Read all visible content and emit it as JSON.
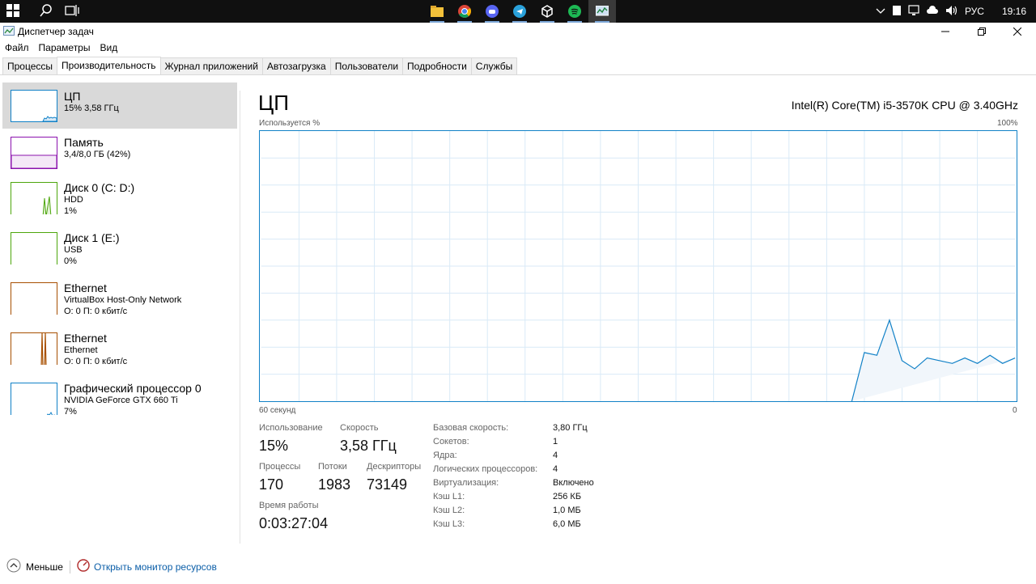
{
  "taskbar": {
    "lang": "РУС",
    "time": "19:16"
  },
  "window": {
    "title": "Диспетчер задач",
    "menu": [
      "Файл",
      "Параметры",
      "Вид"
    ],
    "tabs": [
      "Процессы",
      "Производительность",
      "Журнал приложений",
      "Автозагрузка",
      "Пользователи",
      "Подробности",
      "Службы"
    ],
    "active_tab": 1
  },
  "sidebar": {
    "items": [
      {
        "title": "ЦП",
        "sub1": "15% 3,58 ГГц",
        "sub2": "",
        "sub3": "",
        "color": "#1181c7"
      },
      {
        "title": "Память",
        "sub1": "3,4/8,0 ГБ (42%)",
        "sub2": "",
        "sub3": "",
        "color": "#8b12ae"
      },
      {
        "title": "Диск 0 (C: D:)",
        "sub1": "HDD",
        "sub2": "1%",
        "sub3": "",
        "color": "#4da60c"
      },
      {
        "title": "Диск 1 (E:)",
        "sub1": "USB",
        "sub2": "0%",
        "sub3": "",
        "color": "#4da60c"
      },
      {
        "title": "Ethernet",
        "sub1": "VirtualBox Host-Only Network",
        "sub2": "О: 0 П: 0 кбит/с",
        "sub3": "",
        "color": "#a74f01"
      },
      {
        "title": "Ethernet",
        "sub1": "Ethernet",
        "sub2": "О: 0 П: 0 кбит/с",
        "sub3": "",
        "color": "#a74f01"
      },
      {
        "title": "Графический процессор 0",
        "sub1": "NVIDIA GeForce GTX 660 Ti",
        "sub2": "7%",
        "sub3": "",
        "color": "#1181c7"
      }
    ]
  },
  "cpu": {
    "title": "ЦП",
    "model": "Intel(R) Core(TM) i5-3570K CPU @ 3.40GHz",
    "graph_top_left": "Используется %",
    "graph_top_right": "100%",
    "graph_bottom_left": "60 секунд",
    "graph_bottom_right": "0",
    "stats": {
      "usage_label": "Использование",
      "usage": "15%",
      "speed_label": "Скорость",
      "speed": "3,58 ГГц",
      "procs_label": "Процессы",
      "procs": "170",
      "threads_label": "Потоки",
      "threads": "1983",
      "handles_label": "Дескрипторы",
      "handles": "73149",
      "uptime_label": "Время работы",
      "uptime": "0:03:27:04"
    },
    "specs": [
      {
        "label": "Базовая скорость:",
        "value": "3,80 ГГц"
      },
      {
        "label": "Сокетов:",
        "value": "1"
      },
      {
        "label": "Ядра:",
        "value": "4"
      },
      {
        "label": "Логических процессоров:",
        "value": "4"
      },
      {
        "label": "Виртуализация:",
        "value": "Включено"
      },
      {
        "label": "Кэш L1:",
        "value": "256 КБ"
      },
      {
        "label": "Кэш L2:",
        "value": "1,0 МБ"
      },
      {
        "label": "Кэш L3:",
        "value": "6,0 МБ"
      }
    ]
  },
  "chart_data": {
    "type": "area",
    "title": "",
    "xlabel": "60 секунд",
    "ylabel": "Используется %",
    "xlim": [
      60,
      0
    ],
    "ylim": [
      0,
      100
    ],
    "x": [
      60,
      59,
      58,
      57,
      56,
      55,
      54,
      53,
      52,
      51,
      50,
      49,
      48,
      47,
      46,
      45,
      44,
      43,
      42,
      41,
      40,
      39,
      38,
      37,
      36,
      35,
      34,
      33,
      32,
      31,
      30,
      29,
      28,
      27,
      26,
      25,
      24,
      23,
      22,
      21,
      20,
      19,
      18,
      17,
      16,
      15,
      14,
      13,
      12,
      11,
      10,
      9,
      8,
      7,
      6,
      5,
      4,
      3,
      2,
      1,
      0
    ],
    "series": [
      {
        "values": [
          0,
          0,
          0,
          0,
          0,
          0,
          0,
          0,
          0,
          0,
          0,
          0,
          0,
          0,
          0,
          0,
          0,
          0,
          0,
          0,
          0,
          0,
          0,
          0,
          0,
          0,
          0,
          0,
          0,
          0,
          0,
          0,
          0,
          0,
          0,
          0,
          0,
          0,
          0,
          0,
          0,
          0,
          0,
          0,
          0,
          0,
          0,
          0,
          18,
          17,
          30,
          15,
          12,
          16,
          15,
          14,
          16,
          14,
          17,
          14,
          16,
          20,
          16,
          18,
          18,
          17,
          14
        ]
      }
    ],
    "grid": true,
    "color": "#1181c7"
  },
  "footer": {
    "less": "Меньше",
    "monitor": "Открыть монитор ресурсов"
  }
}
